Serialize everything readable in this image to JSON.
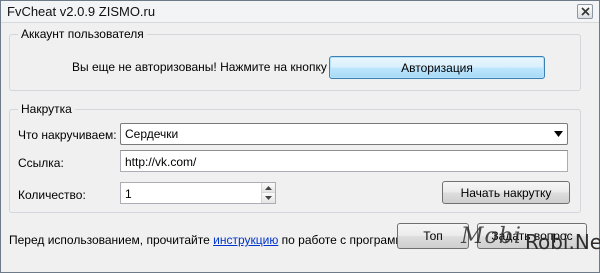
{
  "window": {
    "title": "FvCheat v2.0.9 ZISMO.ru"
  },
  "account": {
    "legend": "Аккаунт пользователя",
    "message": "Вы еще не авторизованы! Нажмите на кнопку",
    "auth_button": "Авторизация"
  },
  "boost": {
    "legend": "Накрутка",
    "what_label": "Что накручиваем:",
    "what_value": "Сердечки",
    "link_label": "Ссылка:",
    "link_value": "http://vk.com/",
    "count_label": "Количество:",
    "count_value": "1",
    "start_button": "Начать накрутку"
  },
  "footer": {
    "before": "Перед использованием, прочитайте",
    "link": "инструкцию",
    "after": "по работе с программой",
    "top_button": "Топ",
    "ask_button": "Задать вопрос"
  },
  "watermark": {
    "mobi": "Mobi",
    "robi": "Robi.Net"
  },
  "icons": {
    "close": "close-icon",
    "dropdown": "chevron-down-icon",
    "spin_up": "spin-up-icon",
    "spin_down": "spin-down-icon"
  }
}
